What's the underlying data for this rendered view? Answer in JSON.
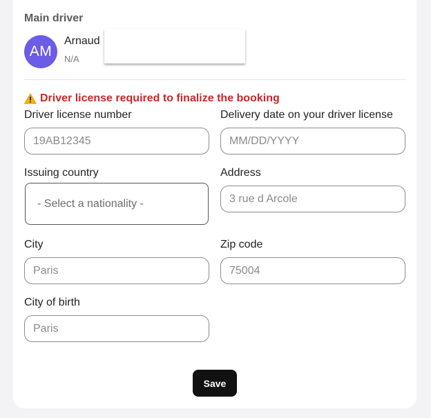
{
  "driver": {
    "section_title": "Main driver",
    "initials": "AM",
    "name": "Arnaud",
    "subtitle": "N/A",
    "avatar_color": "#6c5ce7"
  },
  "warning": {
    "icon": "warning-triangle-icon",
    "text": "Driver license required to finalize the booking",
    "color": "#c62828"
  },
  "form": {
    "license_number": {
      "label": "Driver license number",
      "placeholder": "19AB12345"
    },
    "delivery_date": {
      "label": "Delivery date on your driver license",
      "placeholder": "MM/DD/YYYY"
    },
    "issuing_country": {
      "label": "Issuing country",
      "selected": "- Select a nationality -"
    },
    "address": {
      "label": "Address",
      "placeholder": "3 rue d Arcole"
    },
    "city": {
      "label": "City",
      "placeholder": "Paris"
    },
    "zip_code": {
      "label": "Zip code",
      "placeholder": "75004"
    },
    "city_of_birth": {
      "label": "City of birth",
      "placeholder": "Paris"
    }
  },
  "actions": {
    "save_label": "Save"
  }
}
